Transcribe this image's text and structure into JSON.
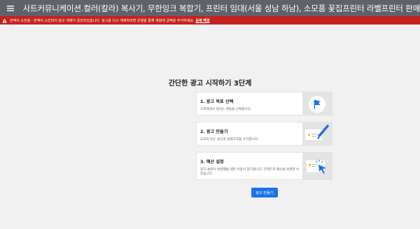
{
  "header": {
    "menu_icon": "hamburger-menu-icon",
    "title": "사트커뮤니케이션.컬러(칼라) 복사기, 무한잉크 복합기, 프린터 임대(서울 성남 하남), 소모품 꽃집프린터 라벨프린터 판매"
  },
  "alert": {
    "icon": "warning-icon",
    "text": "잔액이 소진됨 - 잔액이 소진되어 광고 게재가 중단되었습니다. 광고를 다시 게재하려면 은행을 통해 계정에 금액을 추가하세요.",
    "link": "문제 해결",
    "color": "#c5221f"
  },
  "main": {
    "heading": "간단한 광고 시작하기 3단계",
    "steps": [
      {
        "title": "1. 광고 목표 선택",
        "desc": "고객에게서 원하는 행동을 선택합니다.",
        "icon": "flag-icon"
      },
      {
        "title": "2. 광고 만들기",
        "desc": "효과적 있는 광고로 잠재고객을 유치합니다.",
        "icon": "pencil-icon"
      },
      {
        "title": "3. 예산 설정",
        "desc": "광고 클릭이 발생했을 때만 비용이 청구됩니다. 언제든지 예산을 변경할 수 있습니다.",
        "icon": "cursor-click-icon"
      }
    ],
    "cta": "광고 만들기"
  },
  "colors": {
    "topbar": "#5f6368",
    "primary": "#1a73e8",
    "background": "#f1f1f1"
  }
}
